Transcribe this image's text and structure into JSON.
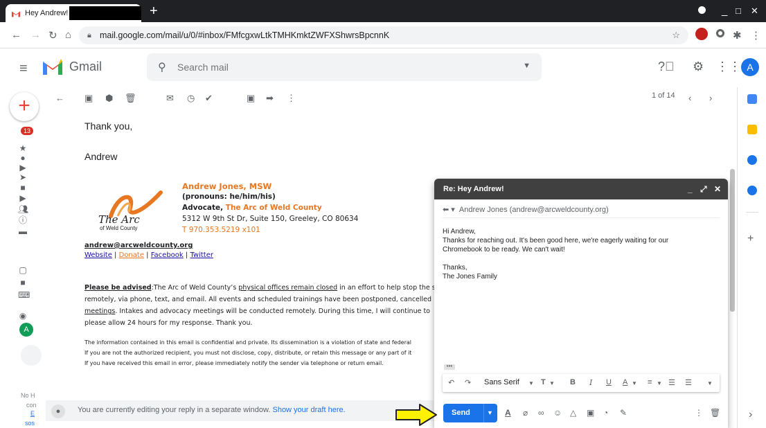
{
  "browser": {
    "tab_title": "Hey Andrew! -",
    "new_tab": "+",
    "window_controls": [
      "_",
      "□",
      "✕"
    ],
    "url": "mail.google.com/mail/u/0/#inbox/FMfcgxwLtkTMHKmktZWFXShwrsBpcnnK",
    "profile_initial": "A"
  },
  "gmail": {
    "brand": "Gmail",
    "search_placeholder": "Search mail",
    "user_initial": "A"
  },
  "rail": {
    "badge_count": "13",
    "avatar_initial": "A",
    "bottom_text": [
      "No H",
      "con",
      "E",
      "sos"
    ]
  },
  "toolbar": {
    "pager": "1 of 14"
  },
  "message": {
    "thanks": "Thank you,",
    "name": "Andrew",
    "sig_name": "Andrew Jones, MSW",
    "sig_pronouns": "(pronouns: he/him/his)",
    "sig_role_prefix": "Advocate, ",
    "sig_org": "The Arc of Weld County",
    "sig_address": "5312 W 9th St Dr, Suite 150, Greeley, CO 80634",
    "sig_phone": "T 970.353.5219 x101",
    "logo_text": "The Arc",
    "logo_sub": "of Weld County",
    "email": "andrew@arcweldcounty.org",
    "links": [
      "Website",
      "Donate",
      "Facebook",
      "Twitter"
    ],
    "advised_label": "Please be advised",
    "advised_1": ":The Arc of Weld County’s ",
    "advised_link": "physical offices remain closed",
    "advised_2": " in an effort to help stop the sp",
    "advised_line2": "remotely, via phone, text, and email.  All  events and scheduled trainings have been postponed, cancelled",
    "advised_line3_link": "meetings",
    "advised_line3": ". Intakes and advocacy meetings will be conducted remotely.  During this time, I will continue to",
    "advised_line4": "please allow 24 hours for my response.  Thank you.",
    "conf_1": "The information contained in this email is confidential and private. Its dissemination is a violation of state and federal",
    "conf_2": "If you are not the authorized recipient, you must not disclose, copy, distribute, or retain this message or any part of it",
    "conf_3": "If you have received this email in error, please immediately notify the sender via telephone or return email."
  },
  "reply_bar": {
    "text": "You are currently editing your reply in a separate window. ",
    "link": "Show your draft here."
  },
  "compose": {
    "title": "Re: Hey Andrew!",
    "to": "Andrew Jones (andrew@arcweldcounty.org)",
    "greeting": "Hi Andrew,",
    "line1": "Thanks for reaching out. It's been good here, we're eagerly waiting for our",
    "line2": "Chromebook to be ready. We can't wait!",
    "signoff": "Thanks,",
    "signature": "The Jones Family",
    "font": "Sans Serif",
    "send_label": "Send"
  },
  "colors": {
    "accent": "#1a73e8",
    "arc_orange": "#e87722",
    "compose_header": "#404040",
    "arrow_yellow": "#fff200"
  }
}
